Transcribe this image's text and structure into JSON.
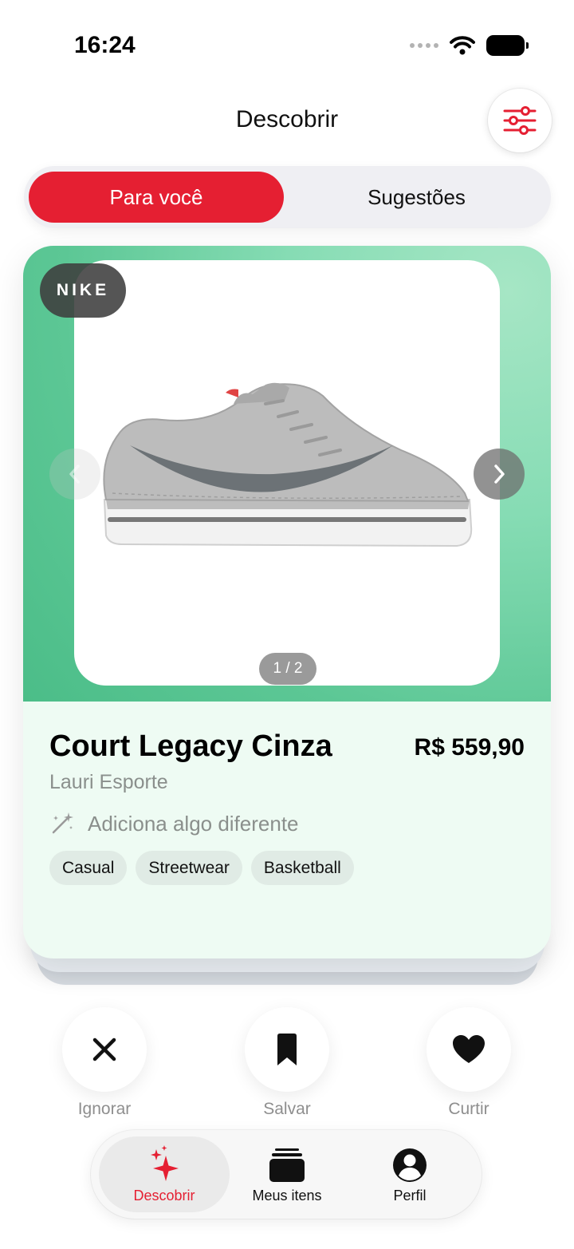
{
  "status_bar": {
    "time": "16:24"
  },
  "header": {
    "title": "Descobrir"
  },
  "segments": {
    "active": "Para você",
    "inactive": "Sugestões"
  },
  "card": {
    "brand": "NIKE",
    "image_index": "1 / 2",
    "product_name": "Court Legacy Cinza",
    "price": "R$ 559,90",
    "store": "Lauri Esporte",
    "insight": "Adiciona algo diferente",
    "tags": [
      "Casual",
      "Streetwear",
      "Basketball"
    ]
  },
  "actions": {
    "ignore": "Ignorar",
    "save": "Salvar",
    "like": "Curtir"
  },
  "tabbar": {
    "discover": "Descobrir",
    "my_items": "Meus itens",
    "profile": "Perfil"
  },
  "colors": {
    "accent": "#e51f32",
    "card_green": "#5cc795",
    "card_bg": "#eefbf3"
  },
  "icons": [
    "wifi-icon",
    "battery-icon",
    "filter-sliders-icon",
    "chevron-left-icon",
    "chevron-right-icon",
    "magic-wand-icon",
    "close-icon",
    "bookmark-icon",
    "heart-icon",
    "sparkles-icon",
    "stack-icon",
    "person-icon"
  ]
}
